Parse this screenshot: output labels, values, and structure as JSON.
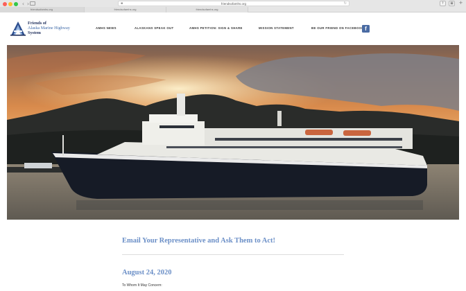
{
  "browser": {
    "address": "friendsofamhs.org",
    "tabs": [
      "friendsofamhs.org",
      "friendsofamhs.org",
      "friendsofamhs.org"
    ],
    "icons": [
      "back-icon",
      "forward-icon",
      "sidebar-icon",
      "lock-icon",
      "reload-icon",
      "share-icon",
      "tabs-icon",
      "new-tab-icon"
    ]
  },
  "logo": {
    "line1": "Friends of",
    "line2": "Alaska Marine Highway",
    "line3": "System"
  },
  "nav": {
    "items": [
      "AMHS NEWS",
      "ALASKANS SPEAK OUT",
      "AMHS PETITION: SIGN & SHARE",
      "MISSION STATEMENT",
      "BE OUR FRIEND ON FACEBOOK"
    ],
    "facebook_glyph": "f"
  },
  "content": {
    "heading": "Email Your Representative and Ask Them to Act!",
    "date": "August 24, 2020",
    "salutation": "To Whom It May Concern:"
  },
  "colors": {
    "accent": "#6b8fc7",
    "logo_dark": "#1f2f5c",
    "facebook": "#4a6ba3"
  }
}
